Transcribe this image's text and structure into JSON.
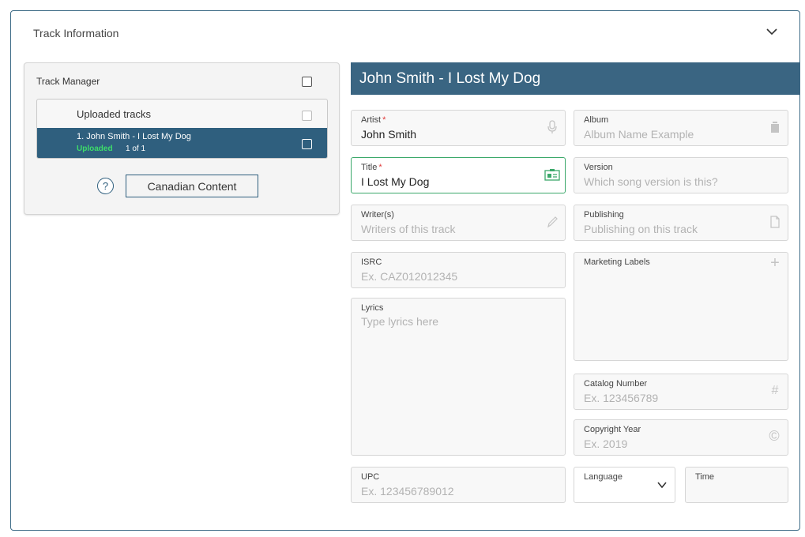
{
  "panel": {
    "title": "Track Information"
  },
  "track_manager": {
    "title": "Track Manager",
    "uploaded_header": "Uploaded tracks",
    "track": {
      "name": "1. John Smith - I Lost My Dog",
      "status": "Uploaded",
      "count": "1 of 1"
    },
    "help_label": "?",
    "canadian_content_label": "Canadian Content"
  },
  "banner": {
    "title": "John Smith - I Lost My Dog"
  },
  "form": {
    "artist": {
      "label": "Artist",
      "required": "*",
      "value": "John Smith"
    },
    "album": {
      "label": "Album",
      "placeholder": "Album Name Example"
    },
    "title": {
      "label": "Title",
      "required": "*",
      "value": "I Lost My Dog"
    },
    "version": {
      "label": "Version",
      "placeholder": "Which song version is this?"
    },
    "writers": {
      "label": "Writer(s)",
      "placeholder": "Writers of this track"
    },
    "publishing": {
      "label": "Publishing",
      "placeholder": "Publishing on this track"
    },
    "isrc": {
      "label": "ISRC",
      "placeholder": "Ex. CAZ012012345"
    },
    "marketing": {
      "label": "Marketing Labels",
      "icon": "+"
    },
    "lyrics": {
      "label": "Lyrics",
      "placeholder": "Type lyrics here"
    },
    "catalog": {
      "label": "Catalog Number",
      "placeholder": "Ex. 123456789",
      "icon": "#"
    },
    "copyright": {
      "label": "Copyright Year",
      "placeholder": "Ex. 2019",
      "icon": "©"
    },
    "upc": {
      "label": "UPC",
      "placeholder": "Ex. 123456789012"
    },
    "language": {
      "label": "Language"
    },
    "time": {
      "label": "Time"
    }
  },
  "colors": {
    "accent": "#3a6582",
    "selected_row": "#2f5f7e",
    "uploaded": "#3ddc6a",
    "required": "#e03a3a",
    "active_border": "#3ba86a"
  }
}
